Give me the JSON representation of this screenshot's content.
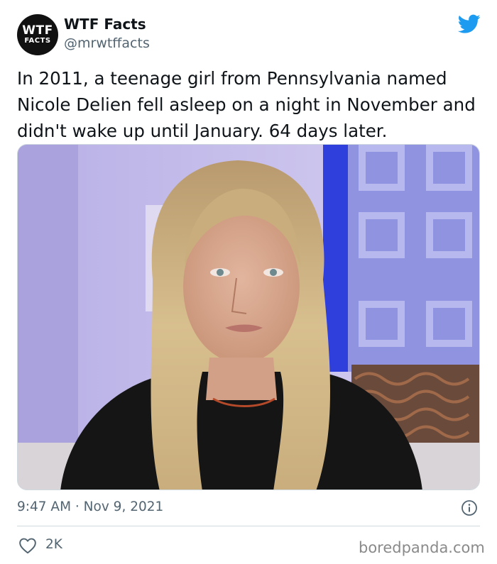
{
  "author": {
    "display_name": "WTF Facts",
    "handle": "@mrwtffacts",
    "avatar_text_top": "WTF",
    "avatar_text_bottom": "FACTS"
  },
  "tweet": {
    "text": "In 2011, a teenage girl from Pennsylvania named Nicole Delien fell asleep on a night in November and didn't wake up until January. 64 days later.",
    "timestamp": "9:47 AM · Nov 9, 2021",
    "like_count": "2K"
  },
  "icons": {
    "brand": "twitter-bird-icon",
    "info": "info-icon",
    "like": "heart-icon"
  },
  "watermark": "boredpanda.com",
  "colors": {
    "twitter_blue": "#1d9bf0",
    "text_primary": "#0f1419",
    "text_secondary": "#536471",
    "border": "#cfd9de"
  }
}
